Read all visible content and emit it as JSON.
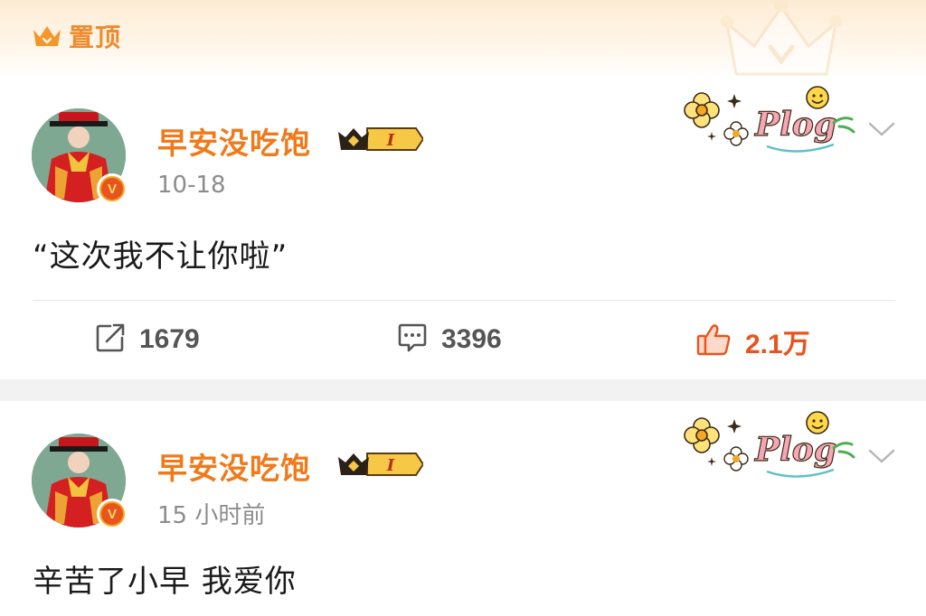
{
  "pinned": {
    "label": "置顶"
  },
  "posts": [
    {
      "username": "早安没吃饱",
      "vip_level": "I",
      "timestamp": "10-18",
      "text": "“这次我不让你啦”",
      "actions": {
        "repost_count": "1679",
        "comment_count": "3396",
        "like_count": "2.1万",
        "liked": true
      }
    },
    {
      "username": "早安没吃饱",
      "vip_level": "I",
      "timestamp": "15 小时前",
      "text": "辛苦了小早 我爱你"
    }
  ],
  "colors": {
    "accent_orange": "#f07a1a",
    "like_red": "#e8541e",
    "muted_gray": "#8c8c8c",
    "separator": "#f2f2f2"
  },
  "icons": {
    "pin": "crown-icon",
    "repost": "repost-icon",
    "comment": "comment-icon",
    "like": "thumbs-up-icon",
    "more": "chevron-down-icon"
  }
}
